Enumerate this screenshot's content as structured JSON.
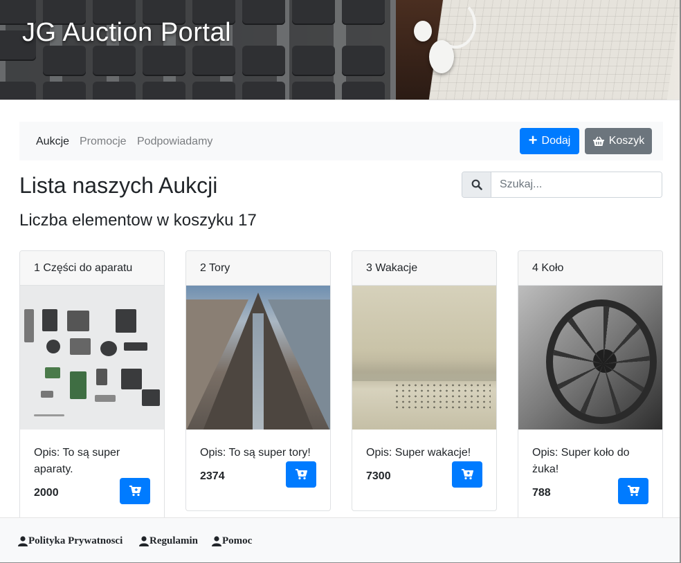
{
  "header": {
    "title": "JG Auction Portal"
  },
  "nav": {
    "links": [
      {
        "label": "Aukcje",
        "active": true
      },
      {
        "label": "Promocje",
        "active": false
      },
      {
        "label": "Podpowiadamy",
        "active": false
      }
    ],
    "add_label": "Dodaj",
    "cart_label": "Koszyk"
  },
  "page": {
    "title": "Lista naszych Aukcji",
    "cart_count_text": "Liczba elementow w koszyku 17"
  },
  "search": {
    "placeholder": "Szukaj...",
    "value": ""
  },
  "cards": [
    {
      "title": "1 Części do aparatu",
      "desc": "Opis: To są super aparaty.",
      "price": "2000"
    },
    {
      "title": "2 Tory",
      "desc": "Opis: To są super tory!",
      "price": "2374"
    },
    {
      "title": "3 Wakacje",
      "desc": "Opis: Super wakacje!",
      "price": "7300"
    },
    {
      "title": "4 Koło",
      "desc": "Opis: Super koło do żuka!",
      "price": "788"
    }
  ],
  "footer": {
    "links": [
      "Polityka Prywatnosci",
      "Regulamin",
      "Pomoc"
    ]
  },
  "colors": {
    "primary": "#007bff",
    "secondary": "#6c757d",
    "light": "#f8f9fa"
  },
  "icons": {
    "add": "plus-icon",
    "cart_nav": "basket-icon",
    "search": "search-icon",
    "card_cart": "cart-plus-icon",
    "footer": "user-icon"
  }
}
